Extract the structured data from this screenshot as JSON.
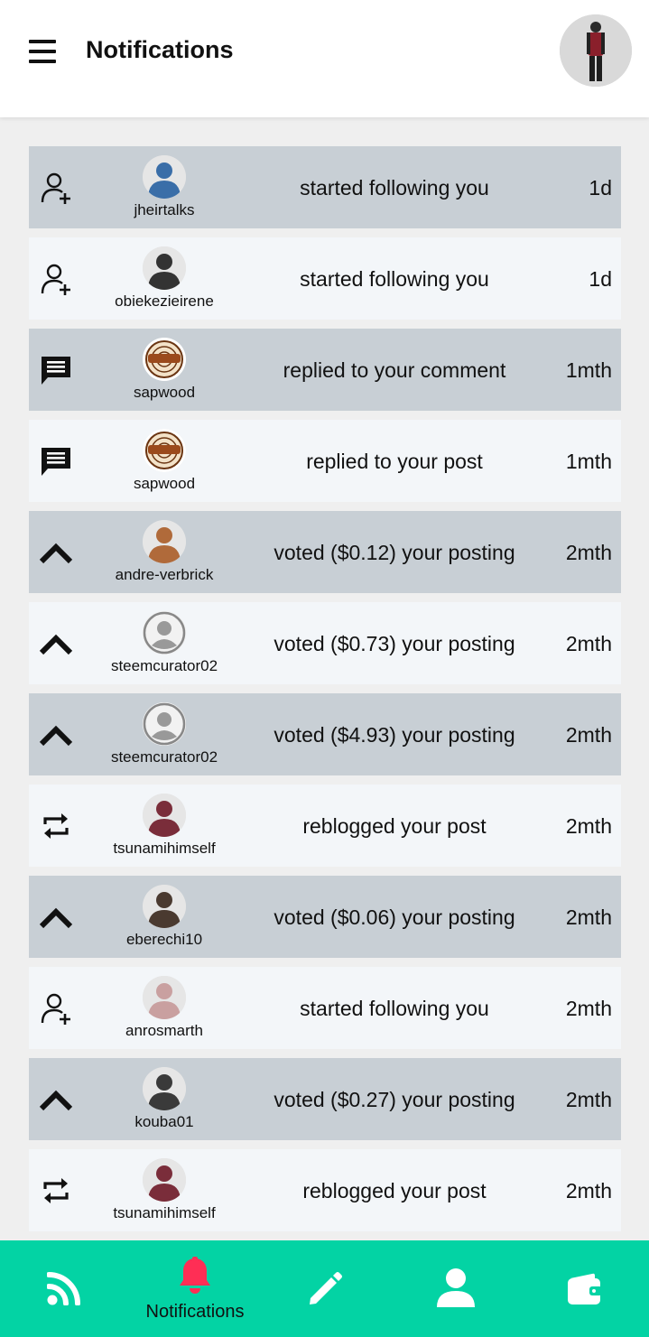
{
  "header": {
    "title": "Notifications",
    "menu_icon": "hamburger-menu-icon",
    "avatar_icon": "profile-avatar"
  },
  "notifications": [
    {
      "type": "follow",
      "icon": "follow-icon",
      "user": "jheirtalks",
      "message": "started following you",
      "time": "1d",
      "avatar_color": "#3a6ea8"
    },
    {
      "type": "follow",
      "icon": "follow-icon",
      "user": "obiekezieirene",
      "message": "started following you",
      "time": "1d",
      "avatar_color": "#333333"
    },
    {
      "type": "reply",
      "icon": "comment-icon",
      "user": "sapwood",
      "message": "replied to your comment",
      "time": "1mth",
      "avatar_color": "#8a4b1c"
    },
    {
      "type": "reply",
      "icon": "comment-icon",
      "user": "sapwood",
      "message": "replied to your post",
      "time": "1mth",
      "avatar_color": "#8a4b1c"
    },
    {
      "type": "vote",
      "icon": "upvote-chevron-icon",
      "user": "andre-verbrick",
      "message": "voted ($0.12) your posting",
      "time": "2mth",
      "avatar_color": "#b06a3a"
    },
    {
      "type": "vote",
      "icon": "upvote-chevron-icon",
      "user": "steemcurator02",
      "message": "voted ($0.73) your posting",
      "time": "2mth",
      "avatar_color": "#9a9a9a"
    },
    {
      "type": "vote",
      "icon": "upvote-chevron-icon",
      "user": "steemcurator02",
      "message": "voted ($4.93) your posting",
      "time": "2mth",
      "avatar_color": "#9a9a9a"
    },
    {
      "type": "reblog",
      "icon": "reblog-icon",
      "user": "tsunamihimself",
      "message": "reblogged your post",
      "time": "2mth",
      "avatar_color": "#7a2d3a"
    },
    {
      "type": "vote",
      "icon": "upvote-chevron-icon",
      "user": "eberechi10",
      "message": "voted ($0.06) your posting",
      "time": "2mth",
      "avatar_color": "#4a3a30"
    },
    {
      "type": "follow",
      "icon": "follow-icon",
      "user": "anrosmarth",
      "message": "started following you",
      "time": "2mth",
      "avatar_color": "#c9a0a0"
    },
    {
      "type": "vote",
      "icon": "upvote-chevron-icon",
      "user": "kouba01",
      "message": "voted ($0.27) your posting",
      "time": "2mth",
      "avatar_color": "#3a3a3a"
    },
    {
      "type": "reblog",
      "icon": "reblog-icon",
      "user": "tsunamihimself",
      "message": "reblogged your post",
      "time": "2mth",
      "avatar_color": "#7a2d3a"
    }
  ],
  "bottom_nav": {
    "items": [
      {
        "icon": "rss-feed-icon",
        "label": ""
      },
      {
        "icon": "bell-icon",
        "label": "Notifications",
        "active": true
      },
      {
        "icon": "pencil-icon",
        "label": ""
      },
      {
        "icon": "user-icon",
        "label": ""
      },
      {
        "icon": "wallet-icon",
        "label": ""
      }
    ]
  },
  "colors": {
    "header_bg": "#ffffff",
    "row_dark": "#c8cfd5",
    "row_light": "#f3f6f9",
    "nav_bg": "#03d3a4",
    "active_bell": "#ff2e55"
  }
}
